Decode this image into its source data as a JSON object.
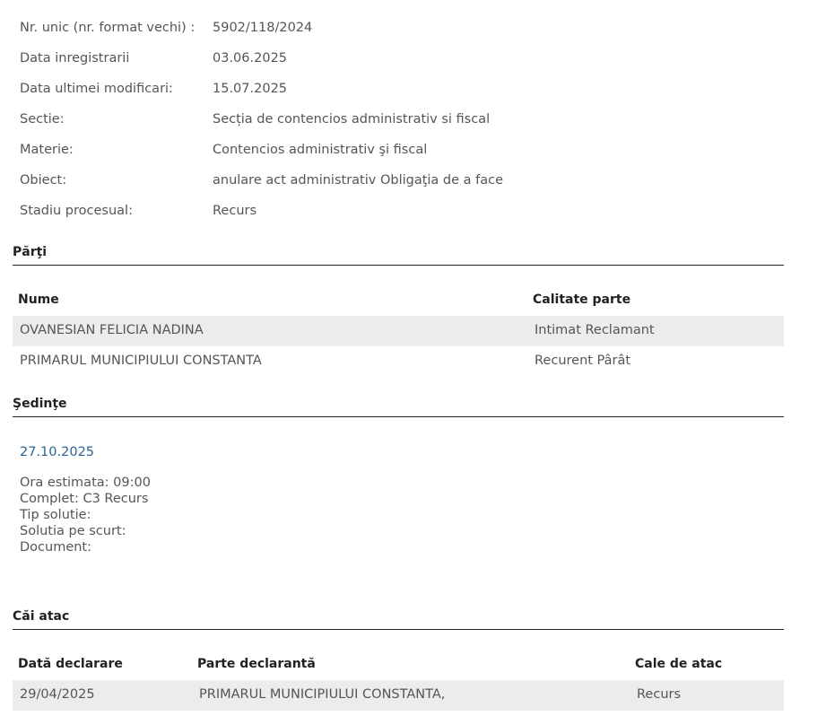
{
  "case_info": [
    {
      "label": "Nr. unic (nr. format vechi) :",
      "value": "5902/118/2024"
    },
    {
      "label": "Data inregistrarii",
      "value": "03.06.2025"
    },
    {
      "label": "Data ultimei modificari:",
      "value": "15.07.2025"
    },
    {
      "label": "Sectie:",
      "value": "Secția de contencios administrativ si fiscal"
    },
    {
      "label": "Materie:",
      "value": "Contencios administrativ şi fiscal"
    },
    {
      "label": "Obiect:",
      "value": "anulare act administrativ Obligaţia de a face"
    },
    {
      "label": "Stadiu procesual:",
      "value": "Recurs"
    }
  ],
  "parties": {
    "title": "Părţi",
    "headers": {
      "name": "Nume",
      "role": "Calitate parte"
    },
    "rows": [
      {
        "name": "OVANESIAN FELICIA NADINA",
        "role": "Intimat Reclamant"
      },
      {
        "name": "PRIMARUL MUNICIPIULUI CONSTANTA",
        "role": "Recurent Pârât"
      }
    ]
  },
  "hearings": {
    "title": "Şedinţe",
    "items": [
      {
        "date": "27.10.2025",
        "details": [
          "Ora estimata: 09:00",
          "Complet: C3 Recurs",
          "Tip solutie:",
          "Solutia pe scurt:",
          "Document:"
        ]
      }
    ]
  },
  "appeals": {
    "title": "Căi atac",
    "headers": {
      "date": "Dată declarare",
      "party": "Parte declarantă",
      "type": "Cale de atac"
    },
    "rows": [
      {
        "date": "29/04/2025",
        "party": "PRIMARUL MUNICIPIULUI CONSTANTA,",
        "type": "Recurs"
      }
    ]
  },
  "colors": {
    "link": "#2a6496",
    "text": "#555555",
    "heading": "#222222",
    "row_shade": "#ececec"
  }
}
